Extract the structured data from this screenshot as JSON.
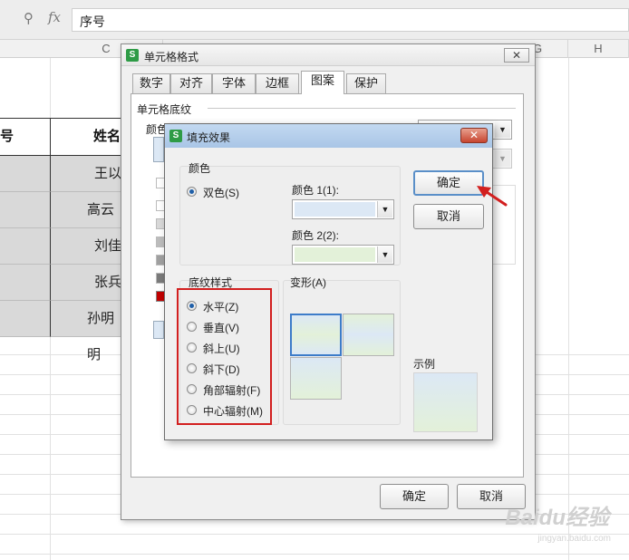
{
  "formula_bar": {
    "fx": "fx",
    "value": "序号"
  },
  "columns": {
    "c": "C",
    "g": "G",
    "h": "H"
  },
  "table": {
    "headers": [
      "号",
      "姓名"
    ],
    "names": [
      "王以",
      "高云瀚",
      "刘佳",
      "张兵",
      "孙明明"
    ]
  },
  "cell_format_dialog": {
    "title": "单元格格式",
    "tabs": [
      "数字",
      "对齐",
      "字体",
      "边框",
      "图案",
      "保护"
    ],
    "active_tab": "图案",
    "section": "单元格底纹",
    "color_label": "颜色",
    "ok": "确定",
    "cancel": "取消"
  },
  "fill_effect_dialog": {
    "title": "填充效果",
    "colors_group": "颜色",
    "two_color": "双色(S)",
    "color1_label": "颜色 1(1):",
    "color2_label": "颜色 2(2):",
    "color1_value": "#dce8f5",
    "color2_value": "#e3f1d9",
    "ok": "确定",
    "cancel": "取消",
    "shading_group": "底纹样式",
    "shading_styles": [
      "水平(Z)",
      "垂直(V)",
      "斜上(U)",
      "斜下(D)",
      "角部辐射(F)",
      "中心辐射(M)"
    ],
    "selected_style": "水平(Z)",
    "variants_group": "变形(A)",
    "sample_label": "示例"
  },
  "watermark": {
    "main": "Baidu经验",
    "sub": "jingyan.baidu.com"
  }
}
